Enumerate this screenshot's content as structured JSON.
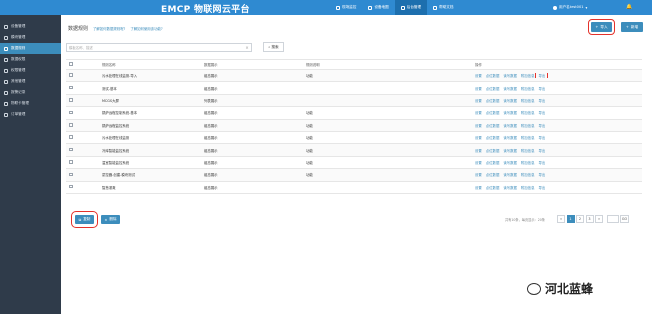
{
  "brand": {
    "name": "EMCP 物联网云平台"
  },
  "topnav": [
    {
      "label": "现场监控",
      "active": false
    },
    {
      "label": "设备地图",
      "active": false
    },
    {
      "label": "后台管理",
      "active": true
    },
    {
      "label": "帮助文档",
      "active": false
    }
  ],
  "user": {
    "label": "用户名test001"
  },
  "sidebar": [
    {
      "label": "设备管理",
      "icon": "grid-icon",
      "active": false
    },
    {
      "label": "模块管理",
      "icon": "cube-icon",
      "active": false
    },
    {
      "label": "数据规则",
      "icon": "pencil-icon",
      "active": true
    },
    {
      "label": "数据权限",
      "icon": "key-icon",
      "active": false
    },
    {
      "label": "权限管理",
      "icon": "users-icon",
      "active": false
    },
    {
      "label": "其他管理",
      "icon": "list-icon",
      "active": false
    },
    {
      "label": "报警记录",
      "icon": "clock-icon",
      "active": false
    },
    {
      "label": "物联卡管理",
      "icon": "card-icon",
      "active": false
    },
    {
      "label": "订单管理",
      "icon": "order-icon",
      "active": false
    }
  ],
  "page": {
    "title": "数据规则",
    "help_link_1": "了解如何数据规则呢?",
    "help_link_2": "了解如何使用该功能?"
  },
  "toolbar": {
    "import_label": "导入",
    "new_label": "新增",
    "search_placeholder": "模板名称、描述",
    "search_label": "搜索"
  },
  "table": {
    "headers": {
      "name": "规则名称",
      "type": "数据展示",
      "desc": "规则说明",
      "ops": "操作"
    },
    "op_labels": [
      "设置",
      "点位数据",
      "读写数据",
      "附加信息",
      "导出"
    ],
    "rows": [
      {
        "name": "污水处理在线监测-导入",
        "type": "组态展示",
        "desc": "功能",
        "highlight_export": true
      },
      {
        "name": "测试-基本",
        "type": "组态展示",
        "desc": "",
        "highlight_export": false
      },
      {
        "name": "MCGS大屏",
        "type": "列表展示",
        "desc": "",
        "highlight_export": false
      },
      {
        "name": "锅炉远程控制系统-基本",
        "type": "组态展示",
        "desc": "功能",
        "highlight_export": false
      },
      {
        "name": "锅炉远程监控系统",
        "type": "组态展示",
        "desc": "功能",
        "highlight_export": false
      },
      {
        "name": "污水处理在线监测",
        "type": "组态展示",
        "desc": "功能",
        "highlight_export": false
      },
      {
        "name": "冷库智能监控系统",
        "type": "组态展示",
        "desc": "功能",
        "highlight_export": false
      },
      {
        "name": "温室智能监控系统",
        "type": "组态展示",
        "desc": "功能",
        "highlight_export": false
      },
      {
        "name": "蒙控器-创建-模块测试",
        "type": "组态展示",
        "desc": "功能",
        "highlight_export": false
      },
      {
        "name": "智慧灌溉",
        "type": "组态展示",
        "desc": "",
        "highlight_export": false
      }
    ]
  },
  "bottom": {
    "copy_label": "复制",
    "delete_label": "删除",
    "page_info": "共有10条，每页显示：20条",
    "pages": [
      "«",
      "1",
      "2",
      "3",
      "»"
    ],
    "go_label": "GO"
  },
  "watermark": {
    "text": "河北蓝蜂"
  },
  "colors": {
    "accent": "#3c8dbc",
    "topbar": "#2f8ad1",
    "sidebar": "#2f3b4a",
    "highlight_box": "#e4322b"
  }
}
